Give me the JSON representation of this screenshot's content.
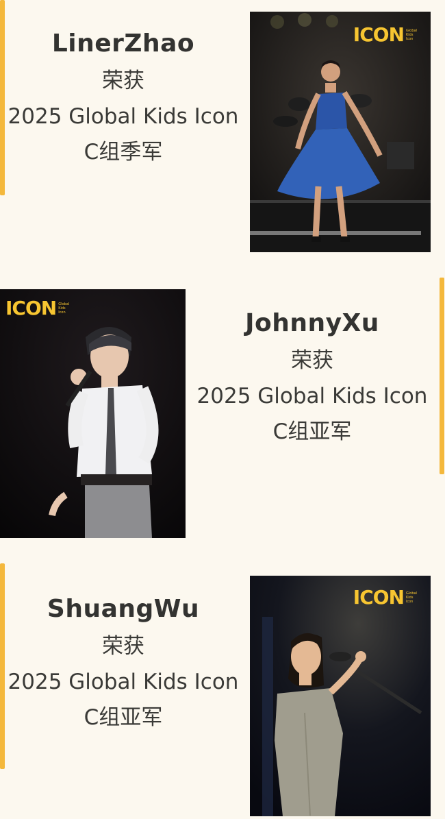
{
  "awards": [
    {
      "name": "LinerZhao",
      "honor": "荣获",
      "event": "2025 Global Kids Icon",
      "result": "C组季军"
    },
    {
      "name": "JohnnyXu",
      "honor": "荣获",
      "event": "2025 Global Kids Icon",
      "result": "C组亚军"
    },
    {
      "name": "ShuangWu",
      "honor": "荣获",
      "event": "2025 Global Kids Icon",
      "result": "C组亚军"
    }
  ],
  "logo": {
    "word": "ICON",
    "tagline": "Global Kids Icon"
  },
  "colors": {
    "background": "#fcf8ef",
    "accent": "#f4b83c",
    "logo": "#f7c531"
  }
}
